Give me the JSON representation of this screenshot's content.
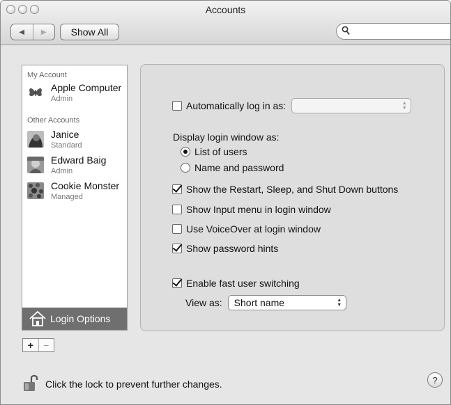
{
  "window": {
    "title": "Accounts"
  },
  "toolbar": {
    "back_glyph": "◀",
    "forward_glyph": "▶",
    "show_all_label": "Show All",
    "search_placeholder": "",
    "search_glyph": "⚲"
  },
  "sidebar": {
    "my_account_header": "My Account",
    "other_accounts_header": "Other Accounts",
    "accounts": [
      {
        "name": "Apple Computer",
        "role": "Admin",
        "icon": "butterfly-icon"
      },
      {
        "name": "Janice",
        "role": "Standard",
        "icon": "user-photo-icon"
      },
      {
        "name": "Edward Baig",
        "role": "Admin",
        "icon": "user-photo-icon"
      },
      {
        "name": "Cookie Monster",
        "role": "Managed",
        "icon": "user-photo-icon"
      }
    ],
    "login_options_label": "Login Options",
    "add_label": "+",
    "remove_label": "−"
  },
  "login_options": {
    "auto_login_label": "Automatically log in as:",
    "auto_login_checked": false,
    "auto_login_value": "",
    "display_as_label": "Display login window as:",
    "display_options": [
      {
        "label": "List of users",
        "selected": true
      },
      {
        "label": "Name and password",
        "selected": false
      }
    ],
    "checkboxes": [
      {
        "label": "Show the Restart, Sleep, and Shut Down buttons",
        "checked": true
      },
      {
        "label": "Show Input menu in login window",
        "checked": false
      },
      {
        "label": "Use VoiceOver at login window",
        "checked": false
      },
      {
        "label": "Show password hints",
        "checked": true
      }
    ],
    "fast_switching_label": "Enable fast user switching",
    "fast_switching_checked": true,
    "view_as_label": "View as:",
    "view_as_value": "Short name"
  },
  "footer": {
    "lock_text": "Click the lock to prevent further changes.",
    "help_label": "?"
  }
}
